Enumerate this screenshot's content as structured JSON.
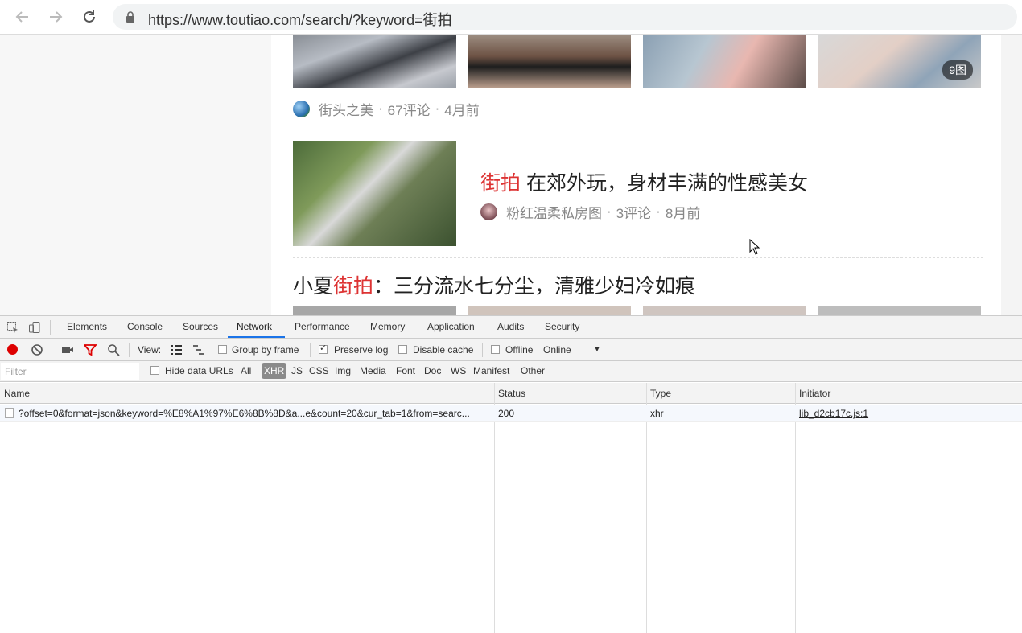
{
  "browser": {
    "url": "https://www.toutiao.com/search/?keyword=街拍"
  },
  "page": {
    "gallery1": {
      "badge": "9图"
    },
    "meta1": {
      "source": "街头之美",
      "comments": "67评论",
      "time": "4月前",
      "sep": "·"
    },
    "article": {
      "highlight": "街拍",
      "title_rest": " 在郊外玩，身材丰满的性感美女",
      "source": "粉红温柔私房图",
      "comments": "3评论",
      "time": "8月前",
      "sep": "·"
    },
    "article2": {
      "prefix": "小夏",
      "highlight": "街拍",
      "rest": "：三分流水七分尘，清雅少妇冷如痕"
    }
  },
  "devtools": {
    "tabs": [
      "Elements",
      "Console",
      "Sources",
      "Network",
      "Performance",
      "Memory",
      "Application",
      "Audits",
      "Security"
    ],
    "active_tab": "Network",
    "toolbar": {
      "view_label": "View:",
      "group_by_frame": "Group by frame",
      "preserve_log": "Preserve log",
      "disable_cache": "Disable cache",
      "offline": "Offline",
      "throttle": "Online"
    },
    "filter": {
      "placeholder": "Filter",
      "hide_data_urls": "Hide data URLs",
      "types": [
        "All",
        "XHR",
        "JS",
        "CSS",
        "Img",
        "Media",
        "Font",
        "Doc",
        "WS",
        "Manifest",
        "Other"
      ],
      "active_type": "XHR"
    },
    "columns": [
      "Name",
      "Status",
      "Type",
      "Initiator"
    ],
    "rows": [
      {
        "name": "?offset=0&format=json&keyword=%E8%A1%97%E6%8B%8D&a...e&count=20&cur_tab=1&from=searc...",
        "status": "200",
        "type": "xhr",
        "initiator": "lib_d2cb17c.js:1"
      }
    ]
  }
}
